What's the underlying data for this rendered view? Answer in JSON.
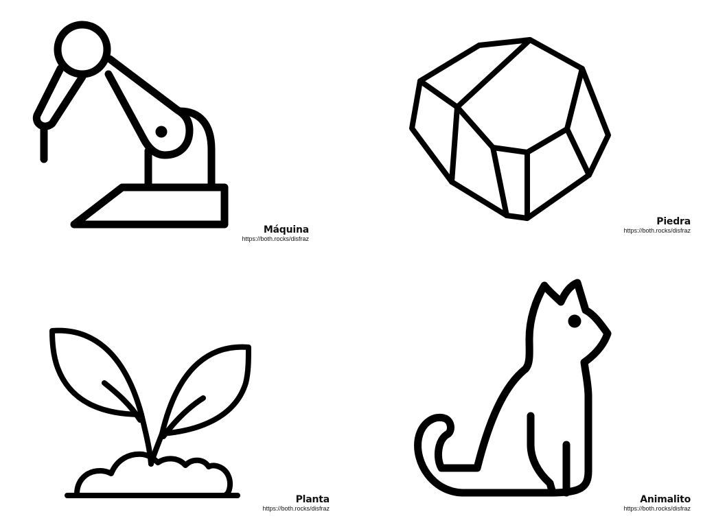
{
  "cards": {
    "machine": {
      "icon": "robotic-arm-icon",
      "label": "Máquina",
      "url": "https://both.rocks/disfraz"
    },
    "stone": {
      "icon": "stone-icon",
      "label": "Piedra",
      "url": "https://both.rocks/disfraz"
    },
    "plant": {
      "icon": "sprout-icon",
      "label": "Planta",
      "url": "https://both.rocks/disfraz"
    },
    "cat": {
      "icon": "cat-icon",
      "label": "Animalito",
      "url": "https://both.rocks/disfraz"
    }
  },
  "colors": {
    "stroke": "#000000",
    "text": "#111111",
    "background": "#ffffff"
  }
}
